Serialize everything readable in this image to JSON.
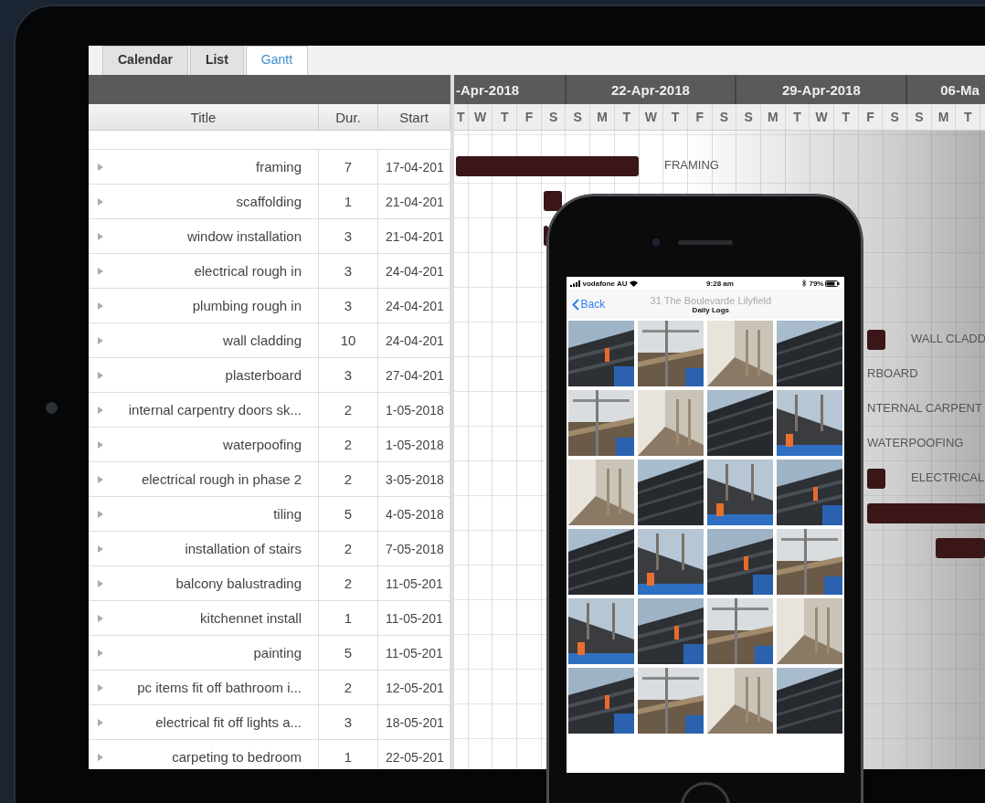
{
  "tabs": [
    {
      "label": "Calendar",
      "selected": false
    },
    {
      "label": "List",
      "selected": false
    },
    {
      "label": "Gantt",
      "selected": true
    }
  ],
  "table": {
    "columns": [
      "Title",
      "Dur.",
      "Start"
    ],
    "rows": [
      {
        "title": "framing",
        "dur": "7",
        "start": "17-04-201",
        "tag": "FRAMING"
      },
      {
        "title": "scaffolding",
        "dur": "1",
        "start": "21-04-201"
      },
      {
        "title": "window installation",
        "dur": "3",
        "start": "21-04-201"
      },
      {
        "title": "electrical rough in",
        "dur": "3",
        "start": "24-04-201"
      },
      {
        "title": "plumbing rough in",
        "dur": "3",
        "start": "24-04-201"
      },
      {
        "title": "wall cladding",
        "dur": "10",
        "start": "24-04-201",
        "tag": "WALL CLADD"
      },
      {
        "title": "plasterboard",
        "dur": "3",
        "start": "27-04-201",
        "tag": "RBOARD"
      },
      {
        "title": "internal carpentry doors sk...",
        "dur": "2",
        "start": "1-05-2018",
        "tag": "NTERNAL CARPENT"
      },
      {
        "title": "waterpoofing",
        "dur": "2",
        "start": "1-05-2018",
        "tag": "WATERPOOFING"
      },
      {
        "title": "electrical rough in phase 2",
        "dur": "2",
        "start": "3-05-2018",
        "tag": "ELECTRICAL"
      },
      {
        "title": "tiling",
        "dur": "5",
        "start": "4-05-2018"
      },
      {
        "title": "installation of stairs",
        "dur": "2",
        "start": "7-05-2018"
      },
      {
        "title": "balcony balustrading",
        "dur": "2",
        "start": "11-05-201"
      },
      {
        "title": "kitchennet install",
        "dur": "1",
        "start": "11-05-201"
      },
      {
        "title": "painting",
        "dur": "5",
        "start": "11-05-201"
      },
      {
        "title": "pc items fit off bathroom i...",
        "dur": "2",
        "start": "12-05-201"
      },
      {
        "title": "electrical fit off lights a...",
        "dur": "3",
        "start": "18-05-201"
      },
      {
        "title": "carpeting to bedroom",
        "dur": "1",
        "start": "22-05-201"
      }
    ]
  },
  "timeline": {
    "weeks": [
      "-Apr-2018",
      "22-Apr-2018",
      "29-Apr-2018",
      "06-Ma"
    ],
    "days": [
      "T",
      "W",
      "T",
      "F",
      "S",
      "S",
      "M",
      "T",
      "W",
      "T",
      "F",
      "S",
      "S",
      "M",
      "T",
      "W",
      "T",
      "F",
      "S",
      "S",
      "M",
      "T"
    ]
  },
  "phone": {
    "carrier": "vodafone AU",
    "time": "9:28 am",
    "battery": "79%",
    "back": "Back",
    "title": "31 The Boulevarde Lilyfield",
    "subtitle": "Daily Logs"
  }
}
